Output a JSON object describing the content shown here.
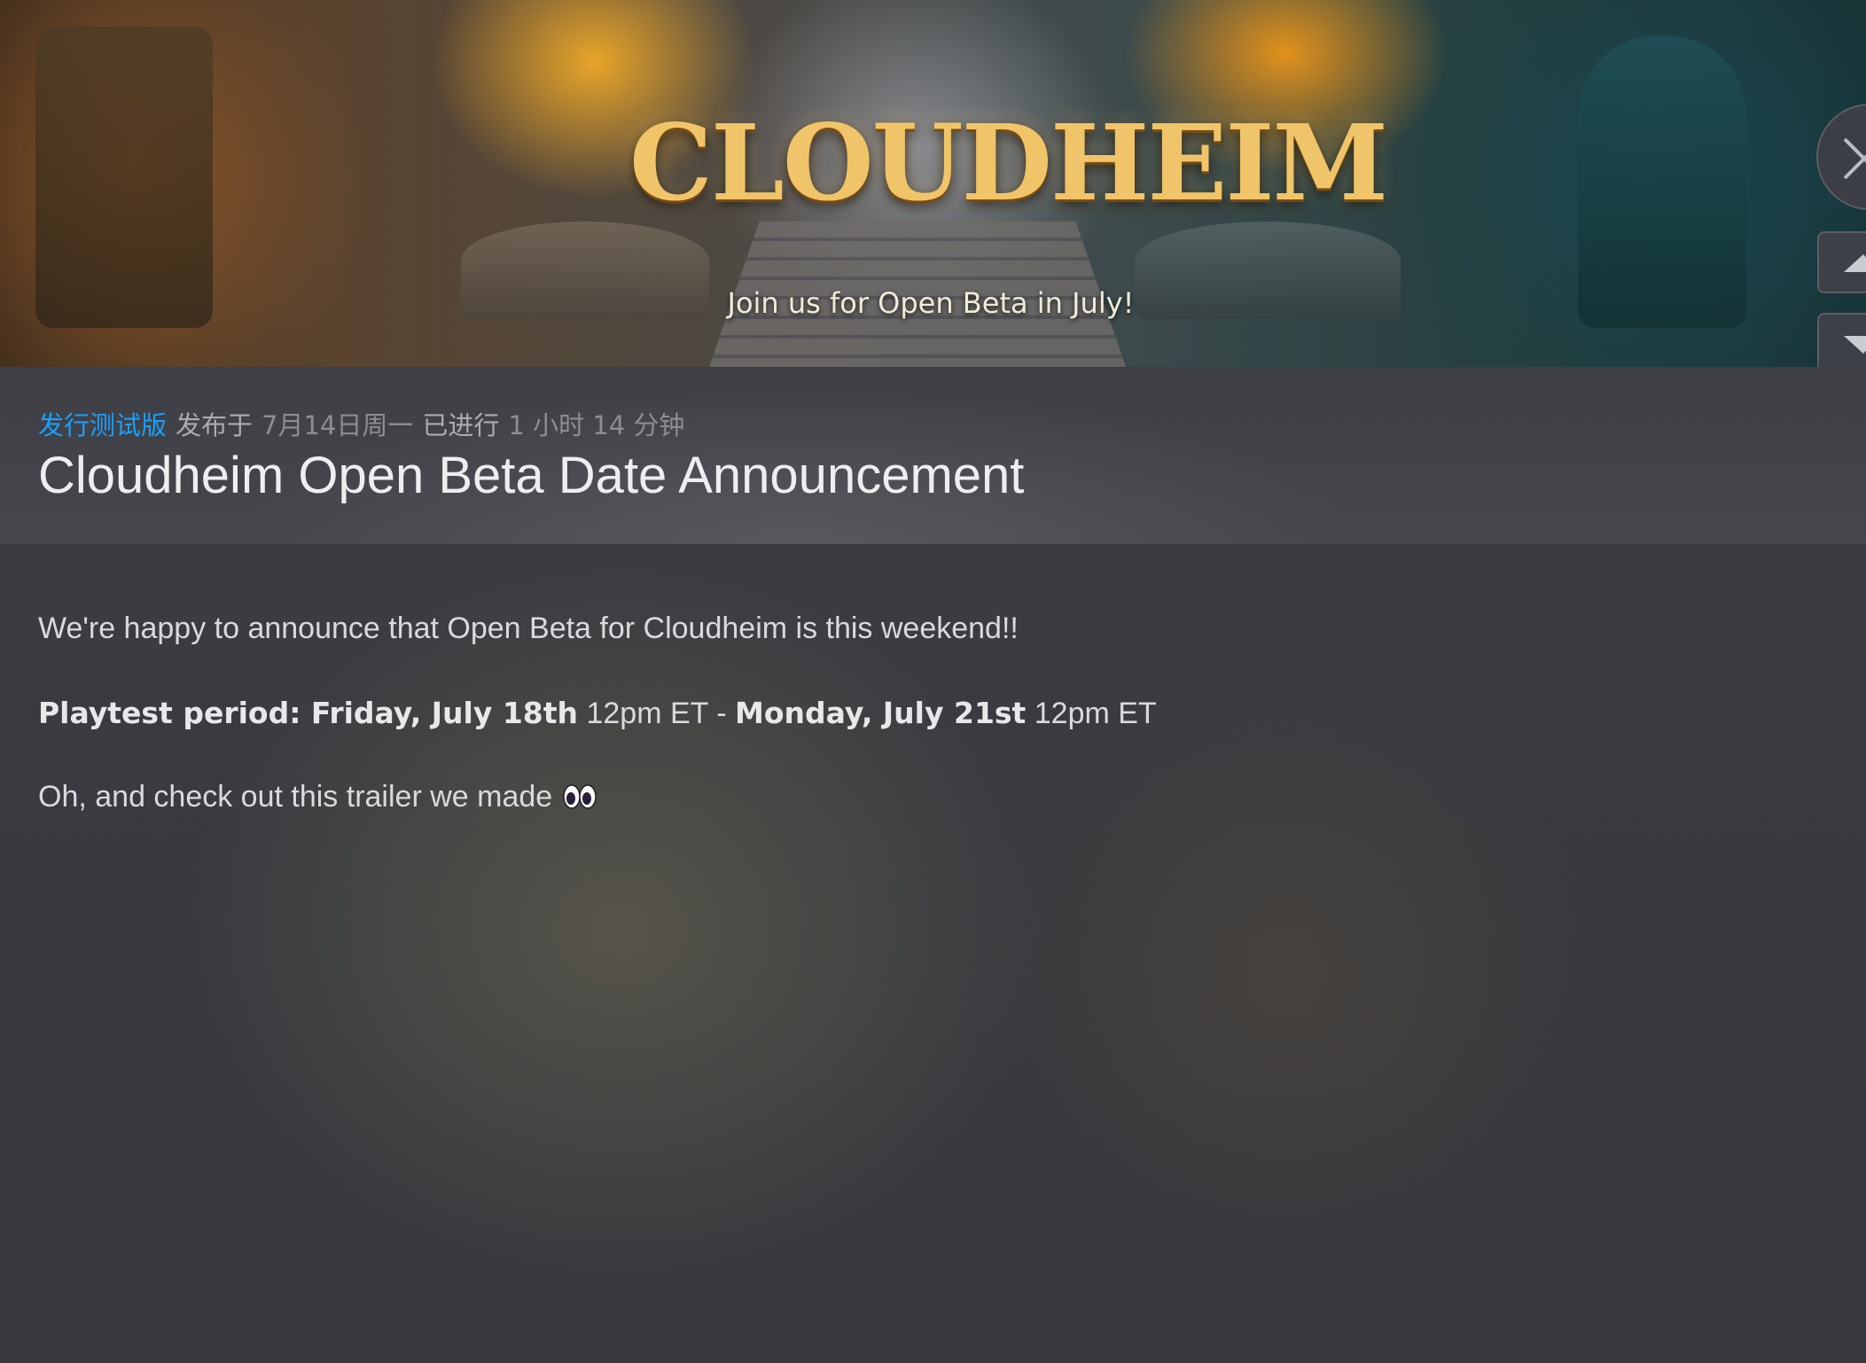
{
  "banner": {
    "logo_text": "CLOUDHEIM",
    "tagline": "Join us for Open Beta in July!"
  },
  "controls": {
    "close_icon": "close-icon",
    "prev_icon": "chevron-up-icon",
    "next_icon": "chevron-down-icon"
  },
  "meta": {
    "tag": "发行测试版",
    "posted_label": "发布于",
    "date": "7月14日周一",
    "ongoing_label": "已进行",
    "duration": "1 小时 14 分钟"
  },
  "title": "Cloudheim Open Beta Date Announcement",
  "body": {
    "paragraph1": "We're happy to announce that Open Beta for Cloudheim is this weekend!!",
    "playtest_label": "Playtest period: Friday, July 18th",
    "playtest_start_time": " 12pm ET - ",
    "playtest_end_day": "Monday, July 21st",
    "playtest_end_time": " 12pm ET",
    "paragraph3": "Oh, and check out this trailer we made",
    "emoji_icon": "eyes-emoji-icon"
  },
  "colors": {
    "accent_blue": "#1a9fff",
    "background": "#3a3c41",
    "title_text": "#eceef0",
    "body_text": "#d8dadd"
  }
}
